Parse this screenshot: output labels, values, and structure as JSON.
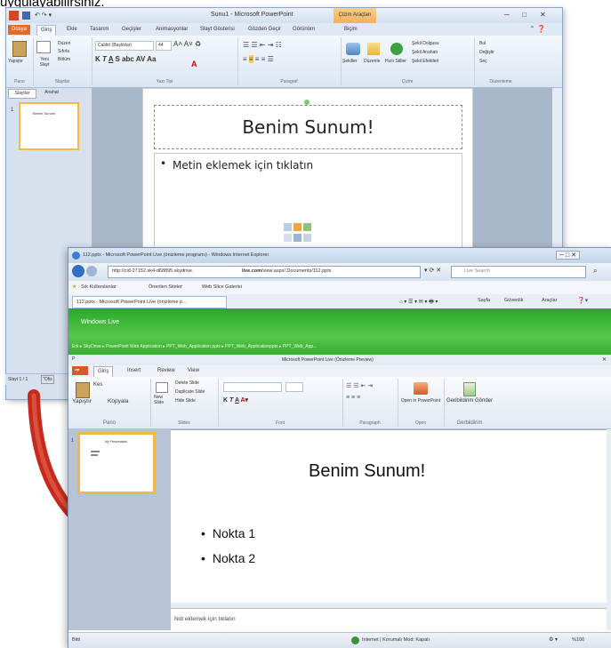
{
  "caption": "uygulayabilirsiniz.",
  "powerpoint": {
    "title": "Sunu1 - Microsoft PowerPoint",
    "context_tab": "Çizim Araçları",
    "tabs": [
      "Dosya",
      "Giriş",
      "Ekle",
      "Tasarım",
      "Geçişler",
      "Animasyonlar",
      "Slayt Gösterisi",
      "Gözden Geçir",
      "Görünüm",
      "Biçim"
    ],
    "groups": [
      "Pano",
      "Slaytlar",
      "Yazı Tipi",
      "Paragraf",
      "Çizim",
      "Düzenleme"
    ],
    "ribbon_items": {
      "paste": "Yapıştır",
      "new_slide": "Yeni Slayt",
      "layout": "Düzen",
      "reset": "Sıfırla",
      "section": "Bölüm",
      "font_name": "Calibri (Başlıklar)",
      "font_size": "44",
      "shapes": "Şekiller",
      "arrange": "Düzenle",
      "quick_styles": "Hızlı Stiller",
      "shape_fill": "Şekil Dolgusu",
      "shape_outline": "Şekil Anahatı",
      "shape_effects": "Şekil Efektleri",
      "find": "Bul",
      "replace": "Değiştir",
      "select": "Seç"
    },
    "pane_tabs": [
      "Slaytlar",
      "Anahat"
    ],
    "thumb_number": "1",
    "thumb_title": "Benim Sunum",
    "slide_title": "Benim Sunum!",
    "slide_bullet": "Metin eklemek için tıklatın",
    "status_slide": "Slayt 1 / 1",
    "status_theme": "\"Ofis"
  },
  "browser": {
    "title": "112.pptx - Microsoft PowerPoint Live (önizleme programı) - Windows Internet Explorer",
    "url_prefix": "http://cid-27152.sk4-d68895.skydrive.",
    "url_domain": "live.com",
    "url_suffix": "/view.aspx/.Documents/112.pptx",
    "search_placeholder": "Live Search",
    "favorites": "Sık Kullanılanlar",
    "fav_suggested": "Önerilen Siteler",
    "fav_gallery": "Web Slice Galerisi",
    "tab_label": "112.pptx - Microsoft PowerPoint Live (önizleme p...",
    "cmd_page": "Sayfa",
    "cmd_safety": "Güvenlik",
    "cmd_tools": "Araçlar",
    "windows_live": "Windows Live",
    "breadcrumb": "Erk ▸ SkyDrive ▸ PowerPoint Web Application ▸ PPT_Web_Application.pptx ▸ PPT_Web_Applicationpptx ▸ PPT_Web_App...",
    "status_left": "Bitti",
    "status_zone": "Internet | Korumalı Mod: Kapalı",
    "zoom": "%100"
  },
  "webapp": {
    "window_title": "Microsoft PowerPoint Live (Önizleme Preview)",
    "file_tab": "P",
    "tabs": [
      "Giriş",
      "Insert",
      "Review",
      "View"
    ],
    "groups": [
      "Pano",
      "Slides",
      "Font",
      "Paragraph",
      "Open",
      "Gerbildirim"
    ],
    "items": {
      "cut": "Kes",
      "paste": "Yapıştır",
      "copy": "Kopyala",
      "new_slide": "New Slide",
      "delete_slide": "Delete Slide",
      "duplicate_slide": "Duplicate Slide",
      "hide_slide": "Hide Slide",
      "open_in_ppt": "Open in PowerPoint",
      "feedback": "Geribildirim Gönder"
    },
    "thumb_number": "1",
    "thumb_title": "My Presentation",
    "slide_title": "Benim Sunum!",
    "bullets": [
      "Nokta 1",
      "Nokta 2"
    ],
    "notes": "Not eklemek için tıklatın"
  },
  "colors": {
    "accent": "#3a9a2f",
    "office_blue": "#dde7f3",
    "file_tab": "#e16b2a",
    "arrow": "#c62a1d"
  }
}
